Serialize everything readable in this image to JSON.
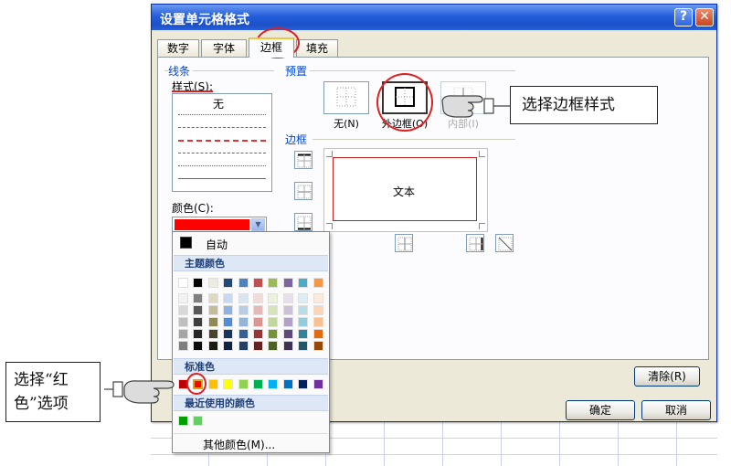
{
  "dialog": {
    "title": "设置单元格格式",
    "help_label": "?",
    "close_label": "✕",
    "tabs": [
      {
        "label": "数字",
        "active": false
      },
      {
        "label": "字体",
        "active": false
      },
      {
        "label": "边框",
        "active": true
      },
      {
        "label": "填充",
        "active": false
      }
    ]
  },
  "line_group": {
    "title": "线条",
    "style_label": "样式(S):",
    "none_label": "无",
    "color_label": "颜色(C):",
    "selected_color": "#ff0000"
  },
  "preset_group": {
    "title": "预置",
    "none_label": "无(N)",
    "outline_label": "外边框(O)",
    "inside_label": "内部(I)"
  },
  "border_group": {
    "title": "边框",
    "preview_text": "文本"
  },
  "buttons": {
    "clear": "清除(R)",
    "ok": "确定",
    "cancel": "取消"
  },
  "color_palette": {
    "automatic_label": "自动",
    "automatic_color": "#000000",
    "theme_header": "主题颜色",
    "theme_top": [
      "#ffffff",
      "#000000",
      "#eeece1",
      "#1f497d",
      "#4f81bd",
      "#c0504d",
      "#9bbb59",
      "#8064a2",
      "#4bacc6",
      "#f79646"
    ],
    "theme_shades": [
      [
        "#f2f2f2",
        "#d8d8d8",
        "#bfbfbf",
        "#a5a5a5",
        "#7f7f7f"
      ],
      [
        "#7f7f7f",
        "#595959",
        "#3f3f3f",
        "#262626",
        "#0c0c0c"
      ],
      [
        "#ddd9c3",
        "#c4bd97",
        "#938953",
        "#494429",
        "#1d1b10"
      ],
      [
        "#c6d9f0",
        "#8db3e2",
        "#548dd4",
        "#17365d",
        "#0f243e"
      ],
      [
        "#dbe5f1",
        "#b8cce4",
        "#95b3d7",
        "#366092",
        "#244061"
      ],
      [
        "#f2dcdb",
        "#e5b9b7",
        "#d99694",
        "#953734",
        "#632423"
      ],
      [
        "#ebf1dd",
        "#d7e3bc",
        "#c3d69b",
        "#76923c",
        "#4f6128"
      ],
      [
        "#e5e0ec",
        "#ccc1d9",
        "#b2a2c7",
        "#5f497a",
        "#3f3151"
      ],
      [
        "#dbeef3",
        "#b7dde8",
        "#92cddc",
        "#31859b",
        "#205867"
      ],
      [
        "#fdeada",
        "#fbd5b5",
        "#fac08f",
        "#e36c09",
        "#974806"
      ]
    ],
    "standard_header": "标准色",
    "standard_colors": [
      "#c00000",
      "#ff0000",
      "#ffc000",
      "#ffff00",
      "#92d050",
      "#00b050",
      "#00b0f0",
      "#0070c0",
      "#002060",
      "#7030a0"
    ],
    "recent_header": "最近使用的颜色",
    "recent_colors": [
      "#00a000",
      "#66cc66"
    ],
    "more_colors_label": "其他颜色(M)..."
  },
  "callouts": {
    "border_style": "选择边框样式",
    "red_color_line1": "选择“红",
    "red_color_line2": "色”选项"
  },
  "accent_colors": {
    "annotation": "#e02020",
    "titlebar": "#245edb"
  }
}
